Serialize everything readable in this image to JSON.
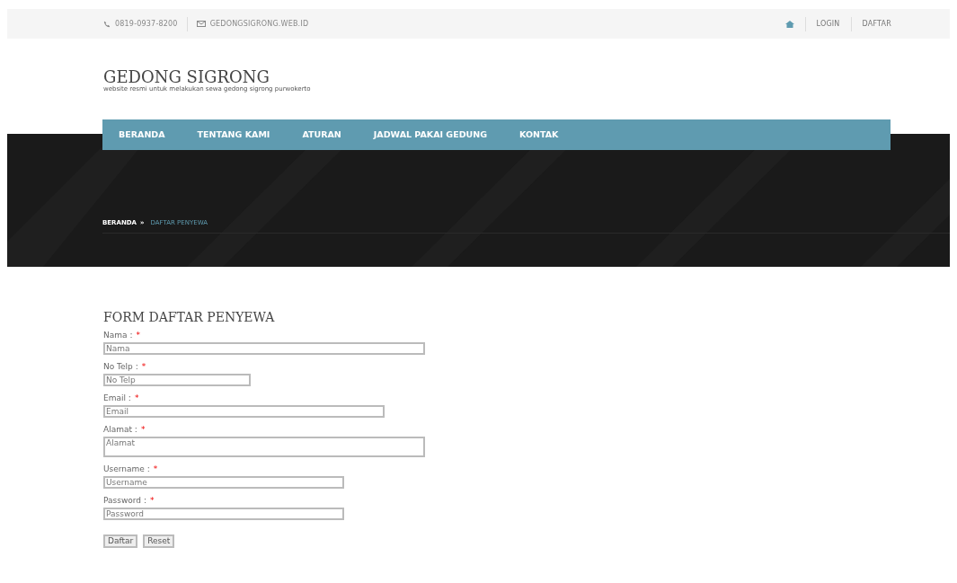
{
  "topbar": {
    "phone": "0819-0937-8200",
    "email": "GEDONGSIGRONG.WEB.ID",
    "links": [
      "LOGIN",
      "DAFTAR"
    ]
  },
  "site": {
    "title": "GEDONG SIGRONG",
    "tagline": "website resmi untuk melakukan sewa gedong sigrong purwokerto"
  },
  "nav": [
    {
      "label": "BERANDA",
      "selected": false
    },
    {
      "label": "TENTANG KAMI",
      "selected": false
    },
    {
      "label": "ATURAN",
      "selected": false
    },
    {
      "label": "JADWAL PAKAI GEDUNG",
      "selected": false
    },
    {
      "label": "KONTAK",
      "selected": false
    }
  ],
  "banner": {
    "kind": "picture",
    "breadcrumb": [
      "BERANDA",
      "DAFTAR PENYEWA"
    ],
    "separator": "»"
  },
  "form": {
    "title": "FORM DAFTAR PENYEWA",
    "required_mark": "*",
    "fields": [
      {
        "label": "Nama :",
        "placeholder": "Nama",
        "kind": "input"
      },
      {
        "label": "No Telp :",
        "placeholder": "No Telp",
        "kind": "input"
      },
      {
        "label": "Email :",
        "placeholder": "Email",
        "kind": "input"
      },
      {
        "label": "Alamat :",
        "placeholder": "Alamat",
        "kind": "textarea"
      },
      {
        "label": "Username :",
        "placeholder": "Username",
        "kind": "input"
      },
      {
        "label": "Password :",
        "placeholder": "Password",
        "kind": "input"
      }
    ],
    "buttons": [
      "Daftar",
      "Reset"
    ]
  }
}
